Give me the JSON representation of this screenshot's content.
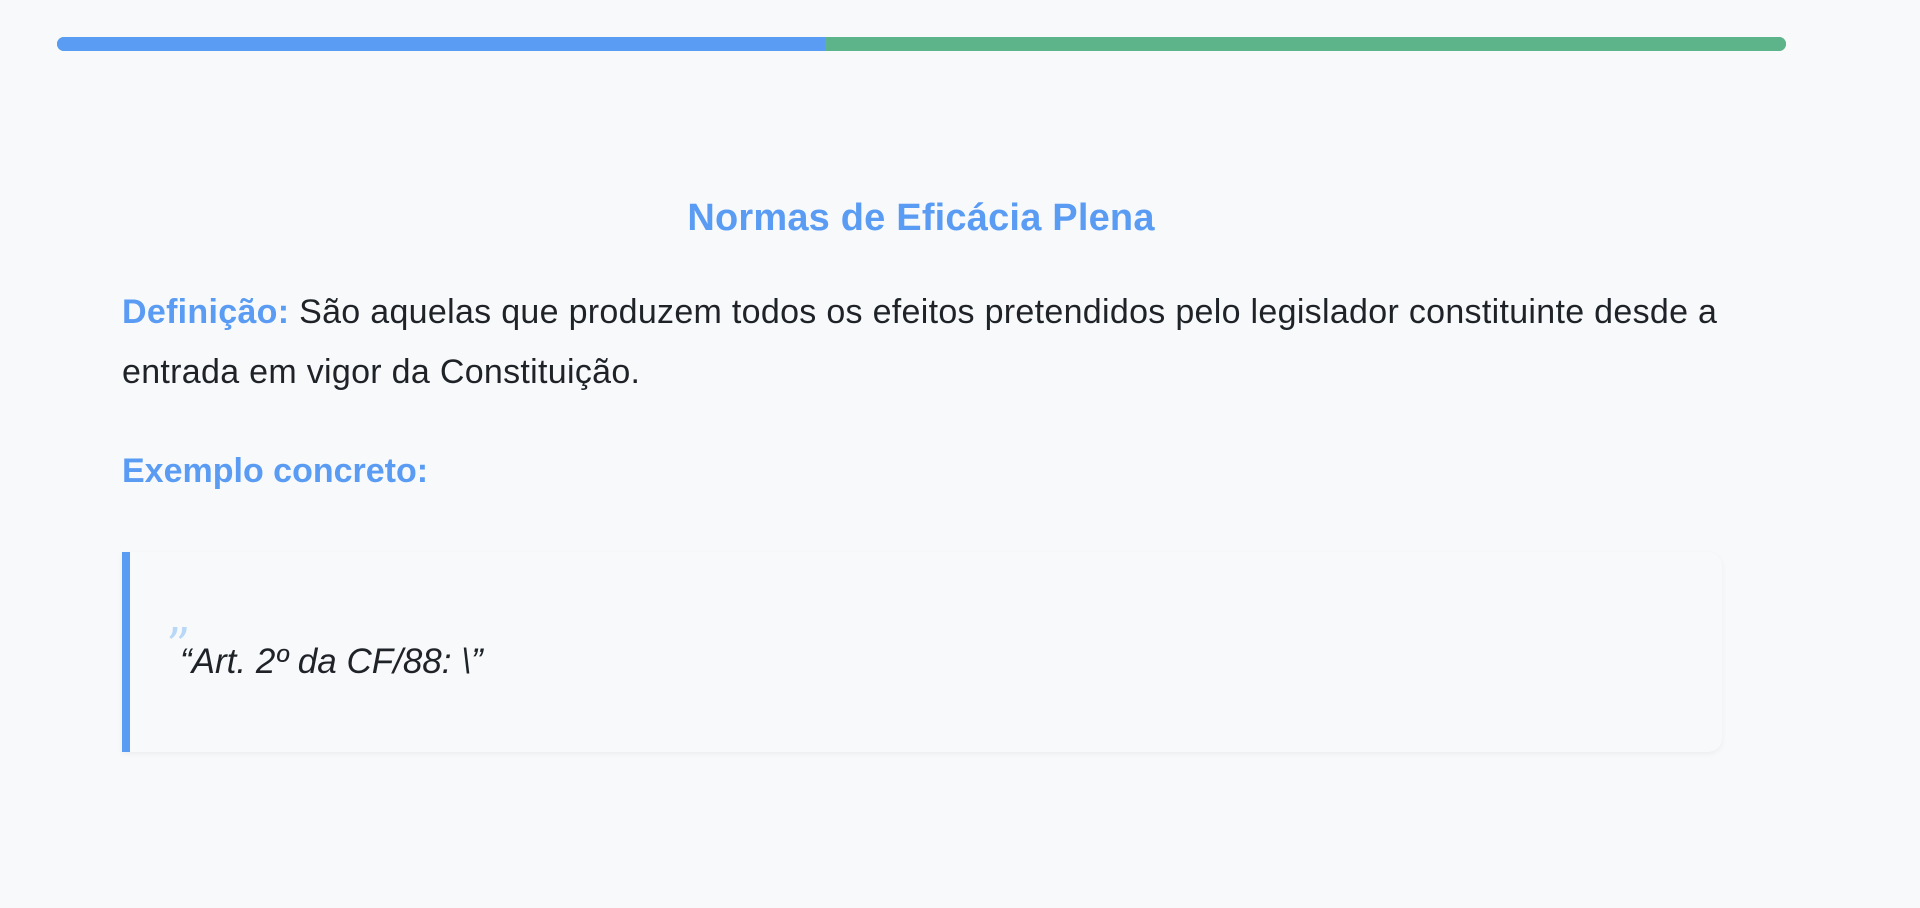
{
  "progress": {
    "value_percent": 44.4,
    "fill_color": "#5a9cf3",
    "rest_color": "#5db38a"
  },
  "card": {
    "title": "Normas de Eficácia Plena",
    "definition_label": "Definição:",
    "definition_text": " São aquelas que produzem todos os efeitos pretendidos pelo legislador constituinte desde a entrada em vigor da Constituição.",
    "example_heading": "Exemplo concreto:",
    "quote_mark": "”",
    "quote_text": "“Art. 2º da CF/88: \\”"
  },
  "colors": {
    "accent": "#5a9cf3",
    "quote_mark": "#b9d7f7"
  }
}
